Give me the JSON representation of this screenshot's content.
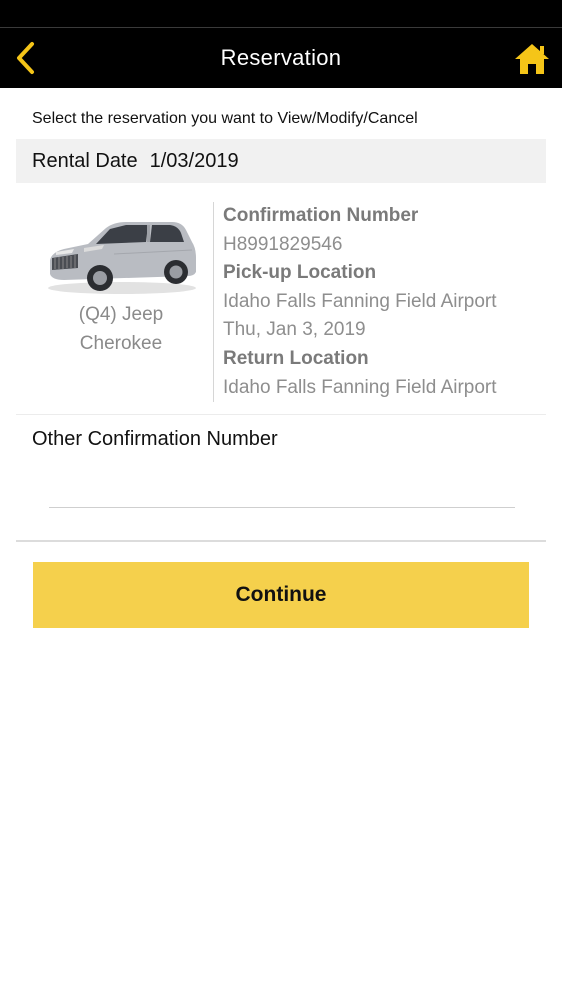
{
  "nav": {
    "title": "Reservation",
    "back_icon": "chevron-left-icon",
    "home_icon": "home-icon",
    "accent_color": "#f5c518"
  },
  "instruction": "Select the reservation you want to View/Modify/Cancel",
  "rental_date": {
    "label": "Rental Date",
    "value": "1/03/2019"
  },
  "reservation": {
    "car_image": "jeep-cherokee-car-image",
    "car_name": "(Q4) Jeep Cherokee",
    "confirmation_label": "Confirmation Number",
    "confirmation_number": "H8991829546",
    "pickup_label": "Pick-up Location",
    "pickup_location": "Idaho Falls Fanning Field Airport",
    "pickup_date": "Thu, Jan 3, 2019",
    "return_label": "Return Location",
    "return_location": "Idaho Falls Fanning Field Airport"
  },
  "other_confirmation": {
    "label": "Other Confirmation Number",
    "value": "",
    "placeholder": ""
  },
  "continue_button": {
    "label": "Continue",
    "color": "#f5d04c"
  }
}
